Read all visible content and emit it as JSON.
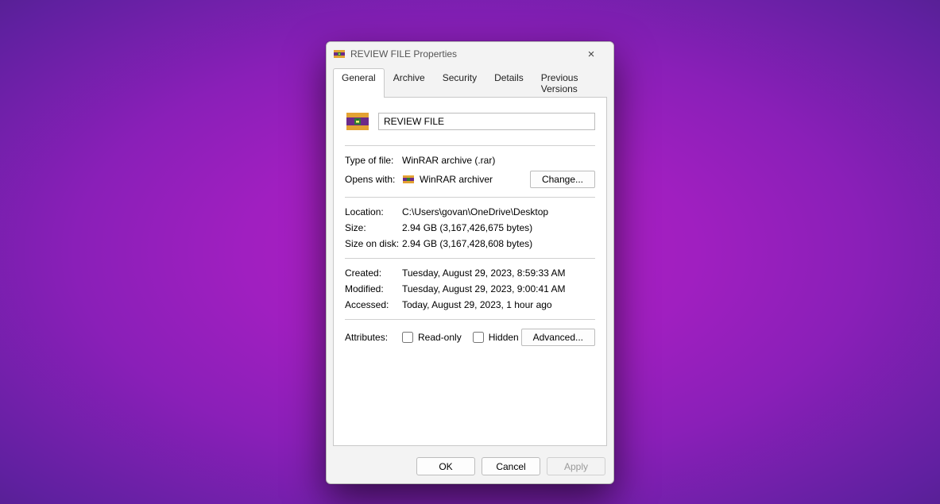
{
  "titlebar": {
    "title": "REVIEW FILE Properties"
  },
  "tabs": {
    "items": [
      {
        "label": "General",
        "active": true
      },
      {
        "label": "Archive",
        "active": false
      },
      {
        "label": "Security",
        "active": false
      },
      {
        "label": "Details",
        "active": false
      },
      {
        "label": "Previous Versions",
        "active": false
      }
    ]
  },
  "file": {
    "name": "REVIEW FILE",
    "type_label": "Type of file:",
    "type_value": "WinRAR archive (.rar)",
    "opens_label": "Opens with:",
    "opens_value": "WinRAR archiver",
    "change_button": "Change...",
    "location_label": "Location:",
    "location_value": "C:\\Users\\govan\\OneDrive\\Desktop",
    "size_label": "Size:",
    "size_value": "2.94 GB (3,167,426,675 bytes)",
    "sizeondisk_label": "Size on disk:",
    "sizeondisk_value": "2.94 GB (3,167,428,608 bytes)",
    "created_label": "Created:",
    "created_value": "Tuesday, August 29, 2023, 8:59:33 AM",
    "modified_label": "Modified:",
    "modified_value": "Tuesday, August 29, 2023, 9:00:41 AM",
    "accessed_label": "Accessed:",
    "accessed_value": "Today, August 29, 2023, 1 hour ago",
    "attributes_label": "Attributes:",
    "readonly_label": "Read-only",
    "hidden_label": "Hidden",
    "advanced_button": "Advanced..."
  },
  "footer": {
    "ok": "OK",
    "cancel": "Cancel",
    "apply": "Apply"
  },
  "icons": {
    "winrar": "winrar-icon",
    "close": "×"
  }
}
